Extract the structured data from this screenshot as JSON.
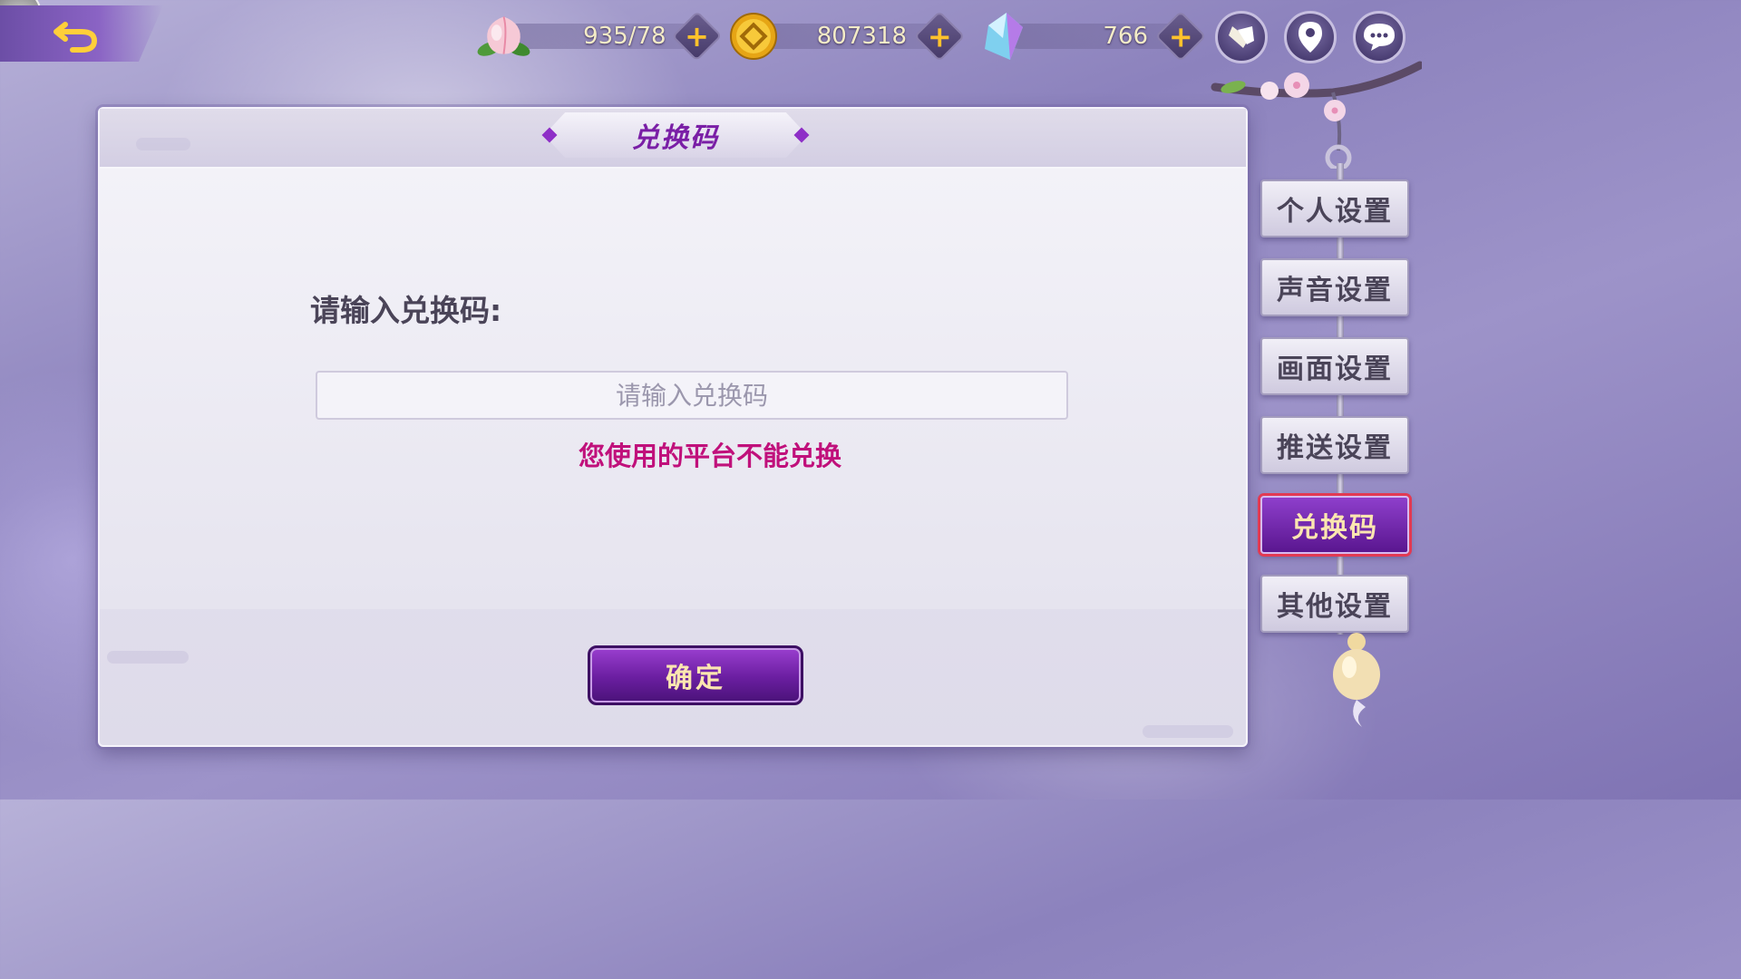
{
  "topbar": {
    "stamina": {
      "icon": "peach-icon",
      "value": "935/78"
    },
    "coins": {
      "icon": "gold-coin-icon",
      "value": "807318"
    },
    "gems": {
      "icon": "crystal-gem-icon",
      "value": "766"
    },
    "plus_label": "+"
  },
  "panel": {
    "title": "兑换码",
    "prompt_label": "请输入兑换码:",
    "input_placeholder": "请输入兑换码",
    "input_value": "",
    "error_message": "您使用的平台不能兑换",
    "confirm_label": "确定"
  },
  "tabs": [
    {
      "label": "个人设置",
      "active": false
    },
    {
      "label": "声音设置",
      "active": false
    },
    {
      "label": "画面设置",
      "active": false
    },
    {
      "label": "推送设置",
      "active": false
    },
    {
      "label": "兑换码",
      "active": true
    },
    {
      "label": "其他设置",
      "active": false
    }
  ],
  "colors": {
    "accent_purple": "#6a1ea0",
    "error_magenta": "#c0107b",
    "gold_text": "#fbe6b0"
  }
}
